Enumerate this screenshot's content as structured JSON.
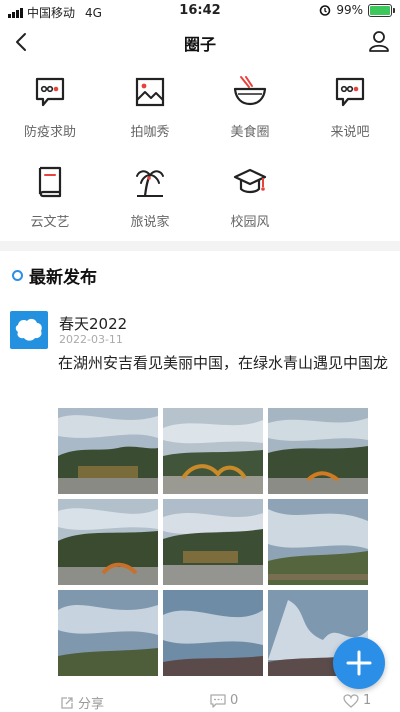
{
  "status_bar": {
    "carrier": "中国移动",
    "network": "4G",
    "time": "16:42",
    "battery": "99%"
  },
  "nav": {
    "title": "圈子"
  },
  "categories": [
    {
      "label": "防疫求助",
      "icon": "chat-bubble-icon"
    },
    {
      "label": "拍咖秀",
      "icon": "picture-icon"
    },
    {
      "label": "美食圈",
      "icon": "food-bowl-icon"
    },
    {
      "label": "来说吧",
      "icon": "chat-bubble-icon"
    },
    {
      "label": "云文艺",
      "icon": "book-icon"
    },
    {
      "label": "旅说家",
      "icon": "palm-tree-icon"
    },
    {
      "label": "校园风",
      "icon": "graduation-cap-icon"
    }
  ],
  "section": {
    "title": "最新发布"
  },
  "post": {
    "user": "春天2022",
    "date": "2022-03-11",
    "text": "在湖州安吉看见美丽中国，在绿水青山遇见中国龙",
    "photo_count": 9
  },
  "actions": {
    "share": "分享",
    "comments": "0",
    "likes": "1"
  },
  "colors": {
    "accent": "#2b8fe8",
    "icon_red": "#e8423c",
    "battery_green": "#3cc85b"
  }
}
